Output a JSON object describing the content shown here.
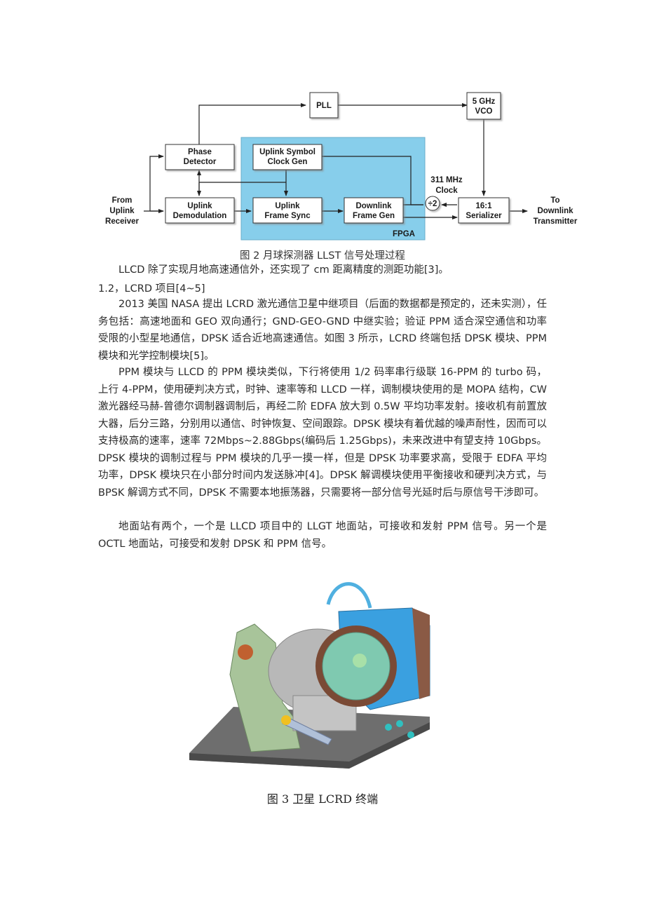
{
  "figure2": {
    "blocks": {
      "pll": "PLL",
      "vco_line1": "5 GHz",
      "vco_line2": "VCO",
      "phase_line1": "Phase",
      "phase_line2": "Detector",
      "demod_line1": "Uplink",
      "demod_line2": "Demodulation",
      "symclk_line1": "Uplink Symbol",
      "symclk_line2": "Clock Gen",
      "framesync_line1": "Uplink",
      "framesync_line2": "Frame Sync",
      "framegen_line1": "Downlink",
      "framegen_line2": "Frame Gen",
      "serializer_line1": "16:1",
      "serializer_line2": "Serializer",
      "divider": "÷2"
    },
    "labels": {
      "from_line1": "From",
      "from_line2": "Uplink",
      "from_line3": "Receiver",
      "to_line1": "To",
      "to_line2": "Downlink",
      "to_line3": "Transmitter",
      "clock_line1": "311 MHz",
      "clock_line2": "Clock",
      "fpga": "FPGA"
    },
    "colors": {
      "fpga_fill": "#87ceeb",
      "box_fill": "#ffffff",
      "line": "#222222"
    },
    "caption": "图 2   月球探测器 LLST 信号处理过程"
  },
  "body": {
    "p1": "LLCD 除了实现月地高速通信外，还实现了 cm 距离精度的测距功能[3]。",
    "heading": "1.2，LCRD 项目[4~5]",
    "p2": "2013 美国 NASA 提出 LCRD 激光通信卫星中继项目（后面的数据都是预定的，还未实测），任务包括：高速地面和 GEO 双向通行；GND-GEO-GND 中继实验；验证 PPM 适合深空通信和功率受限的小型星地通信，DPSK 适合近地高速通信。如图 3 所示，LCRD 终端包括 DPSK 模块、PPM 模块和光学控制模块[5]。",
    "p3": "PPM 模块与 LLCD 的 PPM 模块类似，下行将使用 1/2 码率串行级联 16-PPM 的 turbo 码，上行 4-PPM，使用硬判决方式，时钟、速率等和 LLCD 一样，调制模块使用的是 MOPA 结构，CW 激光器经马赫-曾德尔调制器调制后，再经二阶 EDFA 放大到 0.5W 平均功率发射。接收机有前置放大器，后分三路，分别用以通信、时钟恢复、空间跟踪。DPSK 模块有着优越的噪声耐性，因而可以支持极高的速率，速率 72Mbps~2.88Gbps(编码后 1.25Gbps)，未来改进中有望支持 10Gbps。DPSK 模块的调制过程与 PPM 模块的几乎一摸一样，但是 DPSK 功率要求高，受限于 EDFA 平均功率，DPSK 模块只在小部分时间内发送脉冲[4]。DPSK 解调模块使用平衡接收和硬判决方式，与 BPSK 解调方式不同，DPSK 不需要本地振荡器，只需要将一部分信号光延时后与原信号干涉即可。",
    "p4": "地面站有两个，一个是 LLCD 项目中的 LLGT 地面站，可接收和发射 PPM 信号。另一个是 OCTL 地面站，可接受和发射 DPSK 和 PPM 信号。"
  },
  "figure3": {
    "caption": "图 3 卫星 LCRD 终端",
    "colors": {
      "base_plate": "#6e6e6e",
      "mount": "#a8c49a",
      "housing_blue": "#3aa0e0",
      "lens": "#7fc9b0",
      "rim": "#7a4a35",
      "gray": "#b8b8b8"
    }
  }
}
